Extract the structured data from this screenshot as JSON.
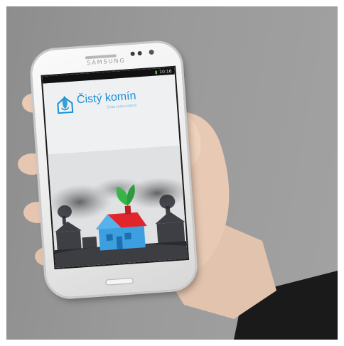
{
  "phone": {
    "brand": "SAMSUNG",
    "status_time": "10:16"
  },
  "app": {
    "title": "Čistý komín",
    "subtitle": "Čistá cesta vzduch"
  },
  "icons": {
    "logo": "house-leaf-logo-icon",
    "illustration": "blue-house-with-leaf-icon"
  },
  "colors": {
    "brand_blue": "#1b8fd6",
    "house_blue": "#3b9fe0",
    "roof_red": "#e0262b",
    "leaf_green": "#38b54a"
  }
}
